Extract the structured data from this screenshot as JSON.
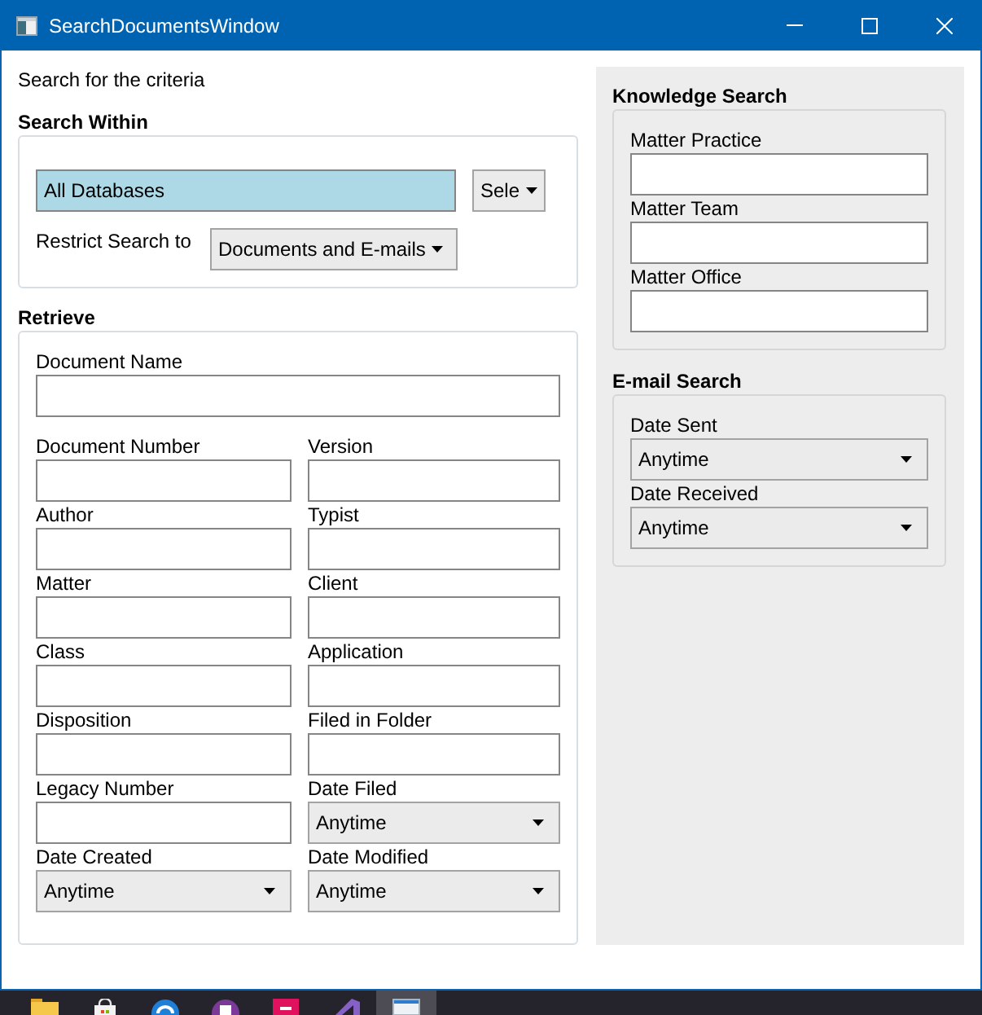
{
  "window": {
    "title": "SearchDocumentsWindow"
  },
  "intro": "Search for the criteria",
  "search_within": {
    "heading": "Search Within",
    "database": {
      "value": "All Databases"
    },
    "database_select": {
      "value": "Sele"
    },
    "restrict": {
      "label": "Restrict Search to",
      "value": "Documents and E-mails"
    }
  },
  "retrieve": {
    "heading": "Retrieve",
    "document_name": {
      "label": "Document Name",
      "kind": "text"
    },
    "fields": [
      {
        "label": "Document Number",
        "kind": "text"
      },
      {
        "label": "Version",
        "kind": "text"
      },
      {
        "label": "Author",
        "kind": "text"
      },
      {
        "label": "Typist",
        "kind": "text"
      },
      {
        "label": "Matter",
        "kind": "text"
      },
      {
        "label": "Client",
        "kind": "text"
      },
      {
        "label": "Class",
        "kind": "text"
      },
      {
        "label": "Application",
        "kind": "text"
      },
      {
        "label": "Disposition",
        "kind": "text"
      },
      {
        "label": "Filed in Folder",
        "kind": "text"
      },
      {
        "label": "Legacy Number",
        "kind": "text"
      },
      {
        "label": "Date Filed",
        "kind": "combo",
        "value": "Anytime"
      },
      {
        "label": "Date Created",
        "kind": "combo",
        "value": "Anytime"
      },
      {
        "label": "Date Modified",
        "kind": "combo",
        "value": "Anytime"
      }
    ]
  },
  "knowledge_search": {
    "heading": "Knowledge Search",
    "fields": [
      {
        "label": "Matter Practice",
        "kind": "text"
      },
      {
        "label": "Matter Team",
        "kind": "text"
      },
      {
        "label": "Matter Office",
        "kind": "text"
      }
    ]
  },
  "email_search": {
    "heading": "E-mail Search",
    "fields": [
      {
        "label": "Date Sent",
        "kind": "combo",
        "value": "Anytime"
      },
      {
        "label": "Date Received",
        "kind": "combo",
        "value": "Anytime"
      }
    ]
  },
  "taskbar": {
    "items": [
      {
        "selected": false
      },
      {
        "selected": false
      },
      {
        "selected": false
      },
      {
        "selected": false
      },
      {
        "selected": false
      },
      {
        "selected": false
      },
      {
        "selected": true
      }
    ]
  }
}
